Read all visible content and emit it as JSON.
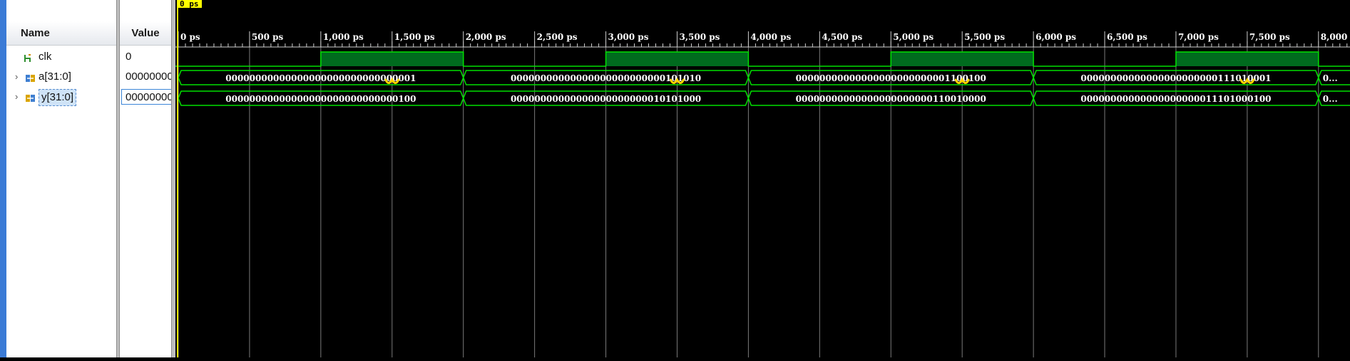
{
  "columns": {
    "name": "Name",
    "value": "Value"
  },
  "cursor": {
    "label": "0 ps"
  },
  "signals": [
    {
      "name": "clk",
      "value": "0",
      "expandable": false,
      "icon": "clock-signal-icon"
    },
    {
      "name": "a[31:0]",
      "value": "00000000",
      "expandable": true,
      "icon": "bus-input-icon"
    },
    {
      "name": "y[31:0]",
      "value": "00000000",
      "expandable": true,
      "icon": "bus-output-icon",
      "selected": true
    }
  ],
  "timeline": {
    "ticks": [
      "0 ps",
      "500 ps",
      "1,000 ps",
      "1,500 ps",
      "2,000 ps",
      "2,500 ps",
      "3,000 ps",
      "3,500 ps",
      "4,000 ps",
      "4,500 ps",
      "5,000 ps",
      "5,500 ps",
      "6,000 ps",
      "6,500 ps",
      "7,000 ps",
      "7,500 ps",
      "8,000"
    ]
  },
  "waves": {
    "clk": {
      "high_intervals_ps": [
        [
          1000,
          2000
        ],
        [
          3000,
          4000
        ],
        [
          5000,
          6000
        ],
        [
          7000,
          8000
        ]
      ]
    },
    "a": [
      {
        "value": "00000000000000000000000000000001"
      },
      {
        "value": "00000000000000000000000000101010"
      },
      {
        "value": "00000000000000000000000001100100"
      },
      {
        "value": "00000000000000000000000111010001"
      },
      {
        "value": "0..."
      }
    ],
    "y": [
      {
        "value": "00000000000000000000000000000100"
      },
      {
        "value": "00000000000000000000000010101000"
      },
      {
        "value": "00000000000000000000000110010000"
      },
      {
        "value": "00000000000000000000011101000100"
      },
      {
        "value": "0..."
      }
    ]
  },
  "colors": {
    "wave": "#00e000",
    "clk_fill": "#006b1e",
    "grid": "#7a7a7a",
    "cursor": "#ffff00",
    "marker": "#ffd400"
  }
}
